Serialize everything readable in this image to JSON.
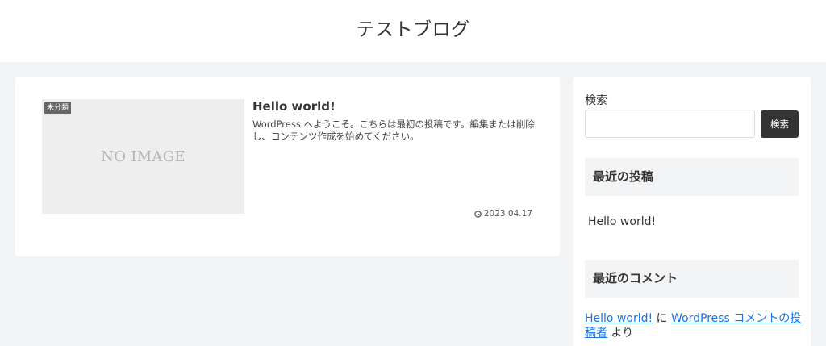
{
  "header": {
    "site_title": "テストブログ"
  },
  "entry": {
    "category": "未分類",
    "thumbnail_text": "NO IMAGE",
    "title": "Hello world!",
    "snippet": "WordPress へようこそ。こちらは最初の投稿です。編集または削除し、コンテンツ作成を始めてください。",
    "date": "2023.04.17",
    "date_icon": "clock-icon"
  },
  "sidebar": {
    "search": {
      "label": "検索",
      "input_value": "",
      "placeholder": "",
      "button_label": "検索"
    },
    "recent_posts": {
      "heading": "最近の投稿",
      "items": [
        "Hello world!"
      ]
    },
    "recent_comments": {
      "heading": "最近のコメント",
      "post_link": "Hello world!",
      "on_text": " に ",
      "author_link": "WordPress コメントの投稿者",
      "by_text": " より"
    }
  },
  "colors": {
    "background": "#f2f3f5",
    "card": "#ffffff",
    "button": "#333333",
    "link": "#1a73e8",
    "badge": "#666666"
  }
}
